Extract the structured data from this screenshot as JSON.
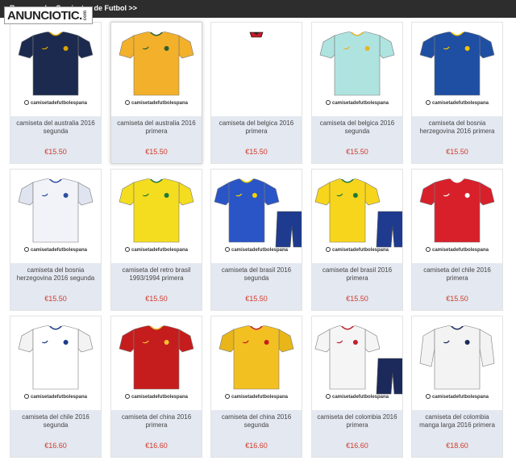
{
  "header": {
    "breadcrumb": "Recomendar Camisetas de Futbol >>",
    "logo_text": "ANUNCIOTIC",
    "logo_dot": ".",
    "logo_tld": "com"
  },
  "watermark": "camisetadefutbolespana",
  "products": [
    {
      "name": "camiseta del australia 2016 segunda",
      "price": "€15.50",
      "icon": "jersey-icon",
      "shirt": "#1b2a4e",
      "accent": "#d9a400",
      "sleeve": "#1b2a4e",
      "shorts": ""
    },
    {
      "name": "camiseta del australia 2016 primera",
      "price": "€15.50",
      "icon": "jersey-icon",
      "shirt": "#f2b02b",
      "accent": "#2e5e2e",
      "sleeve": "#f2b02b",
      "shorts": ""
    },
    {
      "name": "camiseta del belgica 2016 primera",
      "price": "€15.50",
      "icon": "jersey-icon",
      "shirt": "#c21b2a",
      "accent": "#222222",
      "sleeve": "#c21b2a",
      "shorts": "",
      "cropped": true
    },
    {
      "name": "camiseta del belgica 2016 segunda",
      "price": "€15.50",
      "icon": "jersey-icon",
      "shirt": "#aee3e0",
      "accent": "#e8b429",
      "sleeve": "#aee3e0",
      "shorts": ""
    },
    {
      "name": "camiseta del bosnia herzegovina 2016 primera",
      "price": "€15.50",
      "icon": "jersey-icon",
      "shirt": "#1f4fa3",
      "accent": "#f3c400",
      "sleeve": "#1f4fa3",
      "shorts": ""
    },
    {
      "name": "camiseta del bosnia herzegovina 2016 segunda",
      "price": "€15.50",
      "icon": "jersey-icon",
      "shirt": "#f1f3f9",
      "accent": "#2d4fa0",
      "sleeve": "#dfe4f0",
      "shorts": ""
    },
    {
      "name": "camiseta del retro brasil 1993/1994 primera",
      "price": "€15.50",
      "icon": "jersey-icon",
      "shirt": "#f4dd1f",
      "accent": "#1c7a3a",
      "sleeve": "#f4dd1f",
      "shorts": ""
    },
    {
      "name": "camiseta del brasil 2016 segunda",
      "price": "€15.50",
      "icon": "jersey-icon",
      "shirt": "#2a55c7",
      "accent": "#f3d400",
      "sleeve": "#2a55c7",
      "shorts": "#1f3b8f"
    },
    {
      "name": "camiseta del brasil 2016 primera",
      "price": "€15.50",
      "icon": "jersey-icon",
      "shirt": "#f7d51d",
      "accent": "#1c7a3a",
      "sleeve": "#f7d51d",
      "shorts": "#1f3b8f"
    },
    {
      "name": "camiseta del chile 2016 primera",
      "price": "€15.50",
      "icon": "jersey-icon",
      "shirt": "#d8202a",
      "accent": "#ffffff",
      "sleeve": "#d8202a",
      "shorts": ""
    },
    {
      "name": "camiseta del chile 2016 segunda",
      "price": "€16.60",
      "icon": "jersey-icon",
      "shirt": "#ffffff",
      "accent": "#1e3b8a",
      "sleeve": "#f3f3f3",
      "shorts": ""
    },
    {
      "name": "camiseta del china 2016 primera",
      "price": "€16.60",
      "icon": "jersey-icon",
      "shirt": "#c51d1d",
      "accent": "#f2c230",
      "sleeve": "#c51d1d",
      "shorts": ""
    },
    {
      "name": "camiseta del china 2016 segunda",
      "price": "€16.60",
      "icon": "jersey-icon",
      "shirt": "#f3c022",
      "accent": "#c51d1d",
      "sleeve": "#e9b61a",
      "shorts": ""
    },
    {
      "name": "camiseta del colombia 2016 primera",
      "price": "€16.60",
      "icon": "jersey-icon",
      "shirt": "#f5f5f5",
      "accent": "#c2202c",
      "sleeve": "#f5f5f5",
      "shorts": "#1b2a5a"
    },
    {
      "name": "camiseta del colombia manga larga 2016 primera",
      "price": "€18.60",
      "icon": "jersey-icon",
      "shirt": "#f3f3f3",
      "accent": "#1b2a5a",
      "sleeve": "#f3f3f3",
      "shorts": "",
      "long_sleeve": true
    }
  ]
}
